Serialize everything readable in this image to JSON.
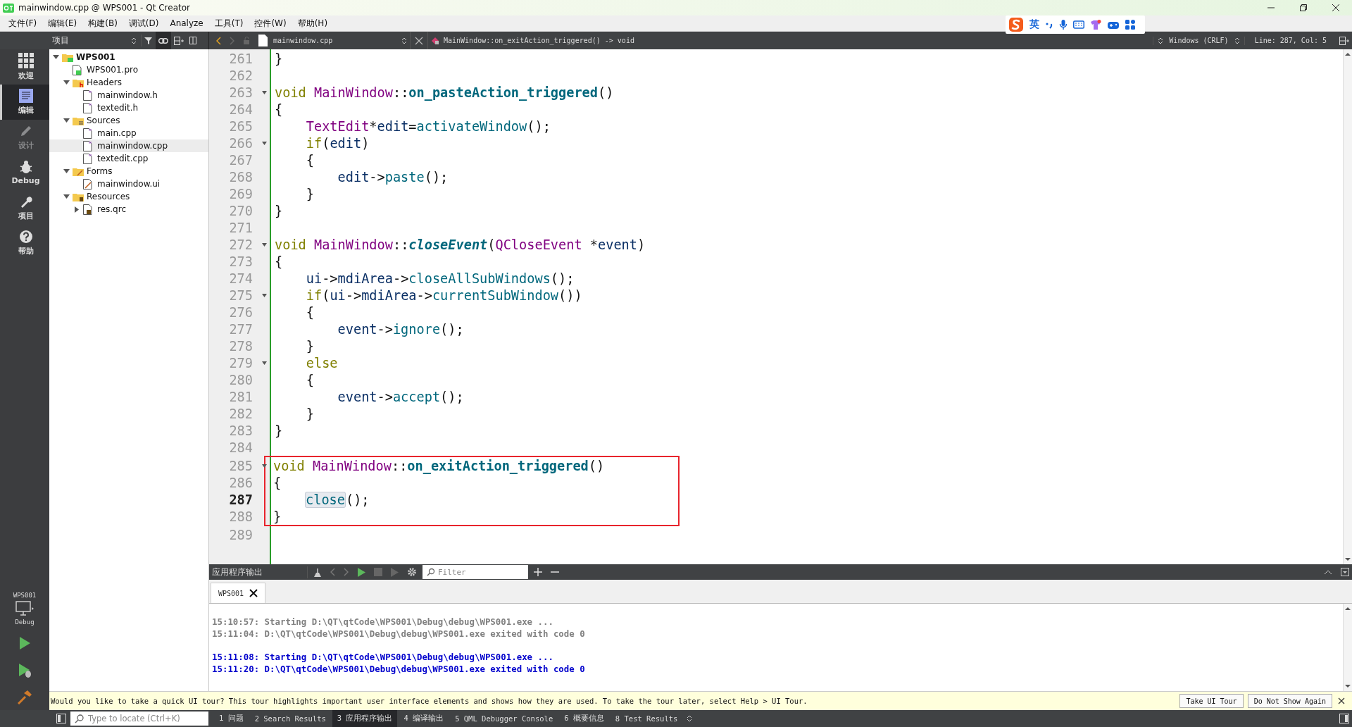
{
  "window": {
    "title": "mainwindow.cpp @ WPS001 - Qt Creator"
  },
  "menu": [
    "文件(F)",
    "编辑(E)",
    "构建(B)",
    "调试(D)",
    "Analyze",
    "工具(T)",
    "控件(W)",
    "帮助(H)"
  ],
  "ime_bar": {
    "mode": "英"
  },
  "toolbar": {
    "panel_combo": "项目",
    "file_combo": "mainwindow.cpp",
    "symbol": "MainWindow::on_exitAction_triggered() -> void",
    "line_ending": "Windows (CRLF)",
    "position": "Line: 287, Col: 5"
  },
  "modes": [
    {
      "label": "欢迎",
      "kind": "grid",
      "selected": false,
      "disabled": false
    },
    {
      "label": "编辑",
      "kind": "edit",
      "selected": true,
      "disabled": false
    },
    {
      "label": "设计",
      "kind": "pencil",
      "selected": false,
      "disabled": true
    },
    {
      "label": "Debug",
      "kind": "bug",
      "selected": false,
      "disabled": false
    },
    {
      "label": "项目",
      "kind": "wrench",
      "selected": false,
      "disabled": false
    },
    {
      "label": "帮助",
      "kind": "help",
      "selected": false,
      "disabled": false
    }
  ],
  "kit": {
    "project": "WPS001",
    "build": "Debug"
  },
  "tree": [
    {
      "label": "WPS001",
      "kind": "project",
      "expanded": true,
      "selected": false,
      "children": [
        {
          "label": "WPS001.pro",
          "kind": "pro",
          "selected": false
        },
        {
          "label": "Headers",
          "kind": "folder-h",
          "expanded": true,
          "selected": false,
          "children": [
            {
              "label": "mainwindow.h",
              "kind": "header",
              "selected": false
            },
            {
              "label": "textedit.h",
              "kind": "header",
              "selected": false
            }
          ]
        },
        {
          "label": "Sources",
          "kind": "folder-cpp",
          "expanded": true,
          "selected": false,
          "children": [
            {
              "label": "main.cpp",
              "kind": "source",
              "selected": false
            },
            {
              "label": "mainwindow.cpp",
              "kind": "source",
              "selected": true
            },
            {
              "label": "textedit.cpp",
              "kind": "source",
              "selected": false
            }
          ]
        },
        {
          "label": "Forms",
          "kind": "folder-ui",
          "expanded": true,
          "selected": false,
          "children": [
            {
              "label": "mainwindow.ui",
              "kind": "form",
              "selected": false
            }
          ]
        },
        {
          "label": "Resources",
          "kind": "folder-res",
          "expanded": true,
          "selected": false,
          "children": [
            {
              "label": "res.qrc",
              "kind": "qrc",
              "expanded": false,
              "selected": false
            }
          ]
        }
      ]
    }
  ],
  "editor": {
    "lines": [
      {
        "number": "261",
        "fold": false,
        "current": false,
        "boxed": false,
        "tokens": [
          {
            "kind": "plain",
            "text": "}"
          }
        ]
      },
      {
        "number": "262",
        "fold": false,
        "current": false,
        "boxed": false
      },
      {
        "number": "263",
        "fold": true,
        "current": false,
        "boxed": false,
        "tokens": [
          {
            "kind": "keyword",
            "text": "void "
          },
          {
            "kind": "class",
            "text": "MainWindow"
          },
          {
            "kind": "plain",
            "text": "::"
          },
          {
            "kind": "decl",
            "text": "on_pasteAction_triggered"
          },
          {
            "kind": "plain",
            "text": "()"
          }
        ]
      },
      {
        "number": "264",
        "fold": false,
        "current": false,
        "boxed": false,
        "tokens": [
          {
            "kind": "plain",
            "text": "{"
          }
        ]
      },
      {
        "number": "265",
        "fold": false,
        "current": false,
        "boxed": false,
        "tokens": [
          {
            "kind": "class",
            "text": "    TextEdit"
          },
          {
            "kind": "plain",
            "text": "*"
          },
          {
            "kind": "var",
            "text": "edit"
          },
          {
            "kind": "plain",
            "text": "="
          },
          {
            "kind": "call",
            "text": "activateWindow"
          },
          {
            "kind": "plain",
            "text": "();"
          }
        ]
      },
      {
        "number": "266",
        "fold": true,
        "current": false,
        "boxed": false,
        "tokens": [
          {
            "kind": "keyword",
            "text": "    if"
          },
          {
            "kind": "plain",
            "text": "("
          },
          {
            "kind": "var",
            "text": "edit"
          },
          {
            "kind": "plain",
            "text": ")"
          }
        ]
      },
      {
        "number": "267",
        "fold": false,
        "current": false,
        "boxed": false,
        "tokens": [
          {
            "kind": "plain",
            "text": "    {"
          }
        ]
      },
      {
        "number": "268",
        "fold": false,
        "current": false,
        "boxed": false,
        "tokens": [
          {
            "kind": "var",
            "text": "        edit"
          },
          {
            "kind": "plain",
            "text": "->"
          },
          {
            "kind": "call",
            "text": "paste"
          },
          {
            "kind": "plain",
            "text": "();"
          }
        ]
      },
      {
        "number": "269",
        "fold": false,
        "current": false,
        "boxed": false,
        "tokens": [
          {
            "kind": "plain",
            "text": "    }"
          }
        ]
      },
      {
        "number": "270",
        "fold": false,
        "current": false,
        "boxed": false,
        "tokens": [
          {
            "kind": "plain",
            "text": "}"
          }
        ]
      },
      {
        "number": "271",
        "fold": false,
        "current": false,
        "boxed": false
      },
      {
        "number": "272",
        "fold": true,
        "current": false,
        "boxed": false,
        "tokens": [
          {
            "kind": "keyword",
            "text": "void "
          },
          {
            "kind": "class",
            "text": "MainWindow"
          },
          {
            "kind": "plain",
            "text": "::"
          },
          {
            "kind": "virtual",
            "text": "closeEvent"
          },
          {
            "kind": "plain",
            "text": "("
          },
          {
            "kind": "class",
            "text": "QCloseEvent"
          },
          {
            "kind": "plain",
            "text": " *"
          },
          {
            "kind": "var",
            "text": "event"
          },
          {
            "kind": "plain",
            "text": ")"
          }
        ]
      },
      {
        "number": "273",
        "fold": false,
        "current": false,
        "boxed": false,
        "tokens": [
          {
            "kind": "plain",
            "text": "{"
          }
        ]
      },
      {
        "number": "274",
        "fold": false,
        "current": false,
        "boxed": false,
        "tokens": [
          {
            "kind": "var",
            "text": "    ui"
          },
          {
            "kind": "plain",
            "text": "->"
          },
          {
            "kind": "var",
            "text": "mdiArea"
          },
          {
            "kind": "plain",
            "text": "->"
          },
          {
            "kind": "call",
            "text": "closeAllSubWindows"
          },
          {
            "kind": "plain",
            "text": "();"
          }
        ]
      },
      {
        "number": "275",
        "fold": true,
        "current": false,
        "boxed": false,
        "tokens": [
          {
            "kind": "keyword",
            "text": "    if"
          },
          {
            "kind": "plain",
            "text": "("
          },
          {
            "kind": "var",
            "text": "ui"
          },
          {
            "kind": "plain",
            "text": "->"
          },
          {
            "kind": "var",
            "text": "mdiArea"
          },
          {
            "kind": "plain",
            "text": "->"
          },
          {
            "kind": "call",
            "text": "currentSubWindow"
          },
          {
            "kind": "plain",
            "text": "())"
          }
        ]
      },
      {
        "number": "276",
        "fold": false,
        "current": false,
        "boxed": false,
        "tokens": [
          {
            "kind": "plain",
            "text": "    {"
          }
        ]
      },
      {
        "number": "277",
        "fold": false,
        "current": false,
        "boxed": false,
        "tokens": [
          {
            "kind": "var",
            "text": "        event"
          },
          {
            "kind": "plain",
            "text": "->"
          },
          {
            "kind": "call",
            "text": "ignore"
          },
          {
            "kind": "plain",
            "text": "();"
          }
        ]
      },
      {
        "number": "278",
        "fold": false,
        "current": false,
        "boxed": false,
        "tokens": [
          {
            "kind": "plain",
            "text": "    }"
          }
        ]
      },
      {
        "number": "279",
        "fold": true,
        "current": false,
        "boxed": false,
        "tokens": [
          {
            "kind": "keyword",
            "text": "    else"
          }
        ]
      },
      {
        "number": "280",
        "fold": false,
        "current": false,
        "boxed": false,
        "tokens": [
          {
            "kind": "plain",
            "text": "    {"
          }
        ]
      },
      {
        "number": "281",
        "fold": false,
        "current": false,
        "boxed": false,
        "tokens": [
          {
            "kind": "var",
            "text": "        event"
          },
          {
            "kind": "plain",
            "text": "->"
          },
          {
            "kind": "call",
            "text": "accept"
          },
          {
            "kind": "plain",
            "text": "();"
          }
        ]
      },
      {
        "number": "282",
        "fold": false,
        "current": false,
        "boxed": false,
        "tokens": [
          {
            "kind": "plain",
            "text": "    }"
          }
        ]
      },
      {
        "number": "283",
        "fold": false,
        "current": false,
        "boxed": false,
        "tokens": [
          {
            "kind": "plain",
            "text": "}"
          }
        ]
      },
      {
        "number": "284",
        "fold": false,
        "current": false,
        "boxed": false
      },
      {
        "number": "285",
        "fold": true,
        "current": false,
        "boxed": true,
        "tokens": [
          {
            "kind": "keyword",
            "text": "void "
          },
          {
            "kind": "class",
            "text": "MainWindow"
          },
          {
            "kind": "plain",
            "text": "::"
          },
          {
            "kind": "decl",
            "text": "on_exitAction_triggered"
          },
          {
            "kind": "plain",
            "text": "()"
          }
        ]
      },
      {
        "number": "286",
        "fold": false,
        "current": false,
        "boxed": true,
        "tokens": [
          {
            "kind": "plain",
            "text": "{"
          }
        ]
      },
      {
        "number": "287",
        "fold": false,
        "current": true,
        "boxed": true,
        "tokens": [
          {
            "kind": "indent-match",
            "text": "close"
          },
          {
            "kind": "plain",
            "text": "();"
          }
        ]
      },
      {
        "number": "288",
        "fold": false,
        "current": false,
        "boxed": true,
        "tokens": [
          {
            "kind": "plain",
            "text": "}"
          }
        ]
      },
      {
        "number": "289",
        "fold": false,
        "current": false,
        "boxed": false
      }
    ]
  },
  "output": {
    "title": "应用程序输出",
    "filter_placeholder": "Filter",
    "tabs": [
      {
        "label": "WPS001",
        "selected": true
      }
    ],
    "lines": [
      {
        "text": "15:10:57: Starting D:\\QT\\qtCode\\WPS001\\Debug\\debug\\WPS001.exe ...",
        "latest": false
      },
      {
        "text": "15:11:04: D:\\QT\\qtCode\\WPS001\\Debug\\debug\\WPS001.exe exited with code 0",
        "latest": false
      },
      {
        "text": "15:11:08: Starting D:\\QT\\qtCode\\WPS001\\Debug\\debug\\WPS001.exe ...",
        "latest": true
      },
      {
        "text": "15:11:20: D:\\QT\\qtCode\\WPS001\\Debug\\debug\\WPS001.exe exited with code 0",
        "latest": true
      }
    ]
  },
  "tour": {
    "message": "Would you like to take a quick UI tour? This tour highlights important user interface elements and shows how they are used. To take the tour later, select Help > UI Tour.",
    "buttons": [
      "Take UI Tour",
      "Do Not Show Again"
    ]
  },
  "status_bar": {
    "locate_placeholder": "Type to locate (Ctrl+K)",
    "panes": [
      {
        "label": "1 问题",
        "selected": false
      },
      {
        "label": "2 Search Results",
        "selected": false
      },
      {
        "label": "3 应用程序输出",
        "selected": true
      },
      {
        "label": "4 编译输出",
        "selected": false
      },
      {
        "label": "5 QML Debugger Console",
        "selected": false
      },
      {
        "label": "6 概要信息",
        "selected": false
      },
      {
        "label": "8 Test Results",
        "selected": false
      }
    ]
  }
}
